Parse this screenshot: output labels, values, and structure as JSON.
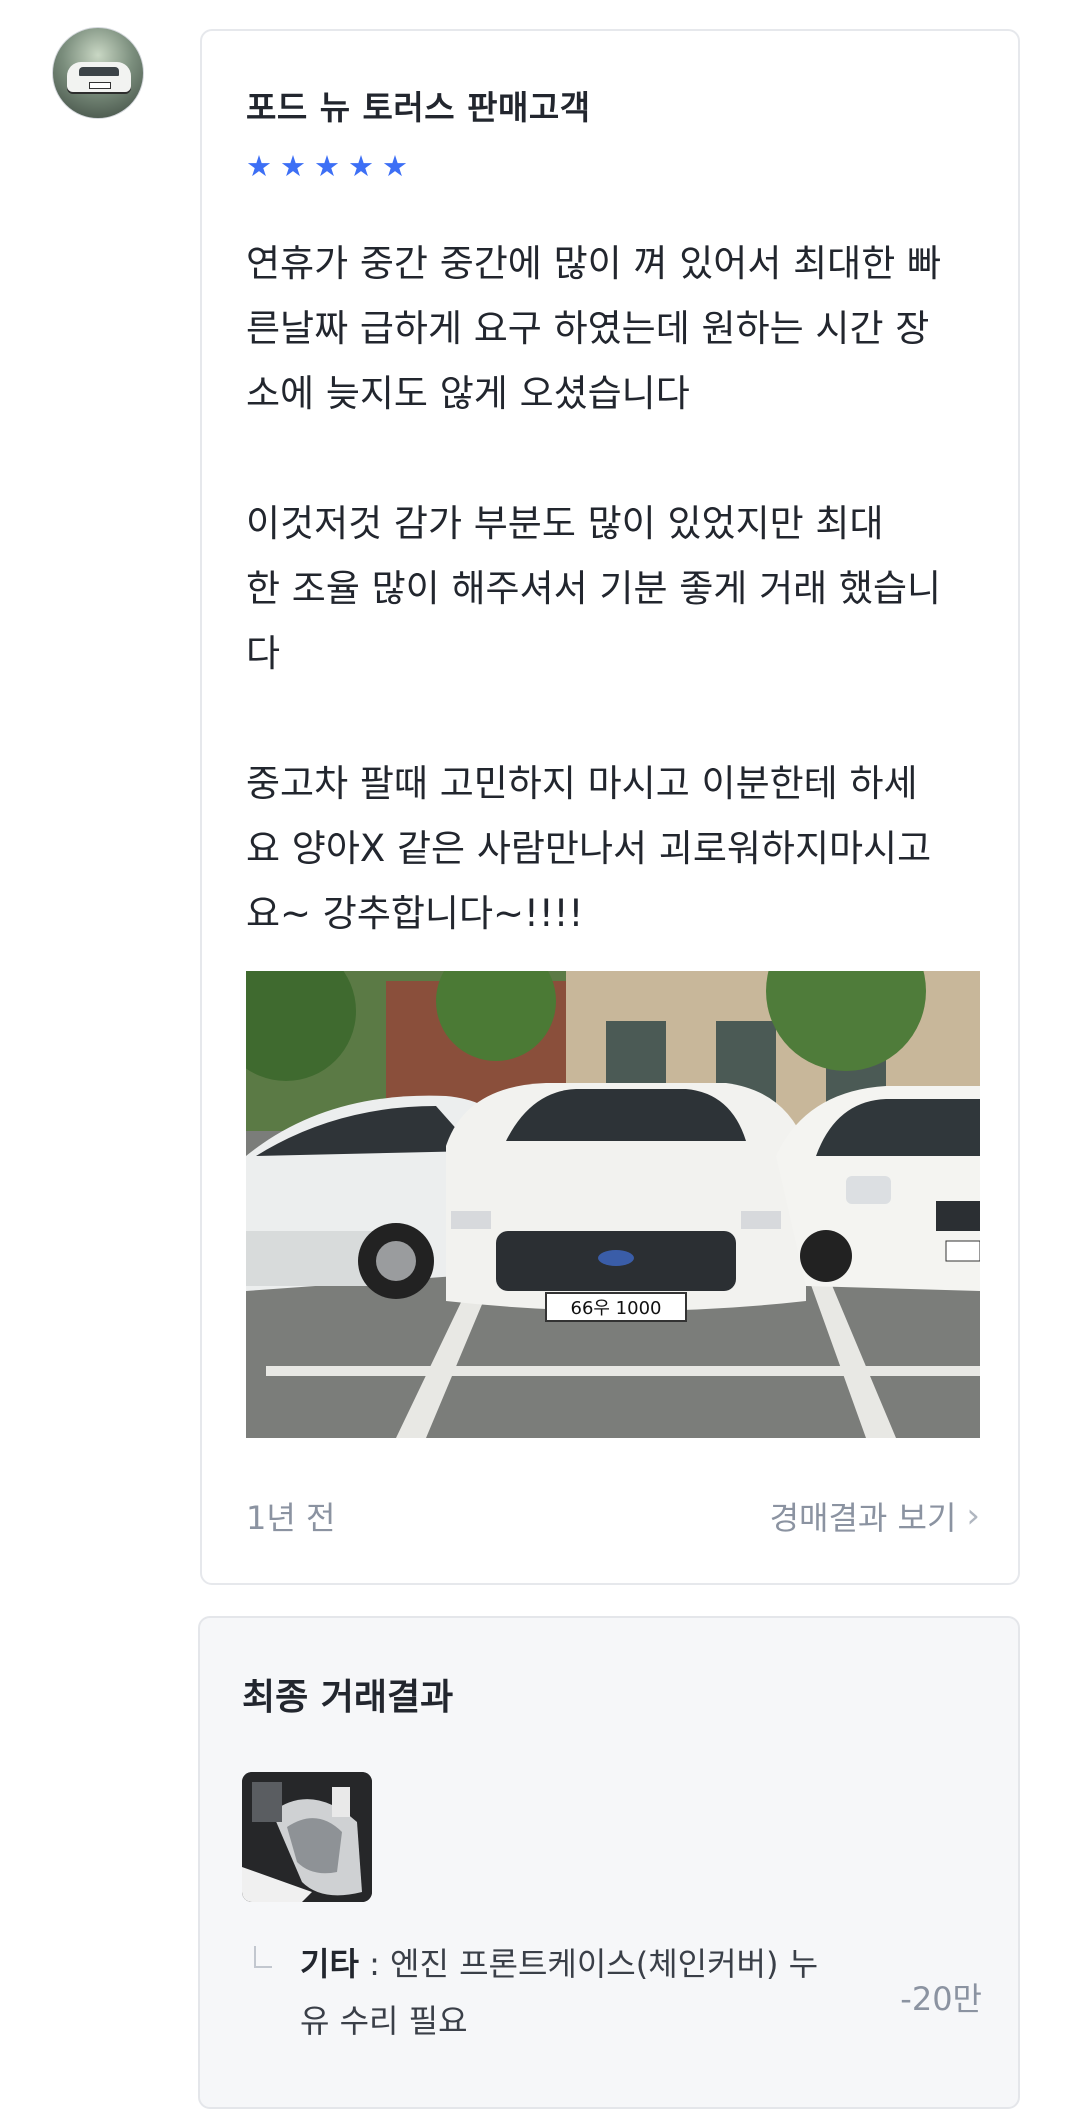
{
  "reviewer": {
    "name": "포드 뉴 토러스 판매고객",
    "rating": 5,
    "avatar_icon": "car-avatar-icon"
  },
  "review": {
    "text": "연휴가 중간 중간에 많이 껴 있어서 최대한 빠\n른날짜 급하게 요구 하였는데 원하는 시간 장\n소에 늦지도 않게 오셨습니다\n\n이것저것 감가 부분도 많이 있었지만 최대\n한 조율 많이 해주셔서 기분 좋게 거래 했습니\n다\n\n중고차 팔때 고민하지 마시고 이분한테 하세\n요 양아X 같은 사람만나서 괴로워하지마시고\n요~ 강추합니다~!!!!",
    "photo_plate": "66우 1000",
    "time": "1년 전",
    "auction_link": "경매결과 보기"
  },
  "result": {
    "title": "최종 거래결과",
    "items": [
      {
        "label": "기타",
        "separator": " : ",
        "description": "엔진 프론트케이스(체인커버) 누유 수리 필요",
        "price": "-20만"
      }
    ]
  },
  "colors": {
    "star": "#3d6ff5",
    "muted_text": "#8b93a1",
    "card_border": "#e6e8ec",
    "result_bg": "#f6f7f9"
  }
}
